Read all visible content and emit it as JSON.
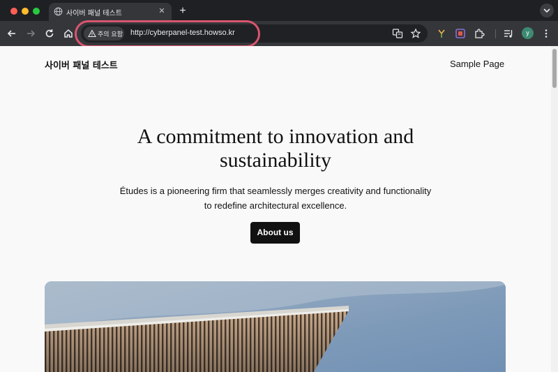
{
  "browser": {
    "tab": {
      "title": "사이버 패널 테스트",
      "icon": "globe-icon"
    },
    "new_tab_symbol": "+",
    "close_symbol": "✕",
    "address_bar": {
      "security_warning": "주의 요함",
      "url": "http://cyberpanel-test.howso.kr"
    },
    "profile_initial": "y",
    "colors": {
      "highlight": "#d9556f",
      "avatar": "#3d8a72"
    }
  },
  "site": {
    "title": "사이버 패널 테스트",
    "nav": [
      "Sample Page"
    ]
  },
  "hero": {
    "heading": "A commitment to innovation and sustainability",
    "text": "Études is a pioneering firm that seamlessly merges creativity and functionality to redefine architectural excellence.",
    "button": "About us"
  }
}
